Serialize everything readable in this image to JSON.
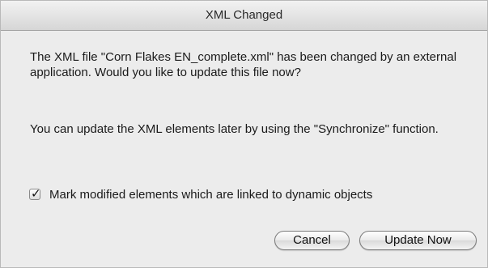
{
  "dialog": {
    "title": "XML Changed",
    "message_primary": "The XML file \"Corn Flakes EN_complete.xml\" has been changed by an external application. Would you like to update this file now?",
    "message_secondary": "You can update the XML elements later by using the \"Synchronize\" function.",
    "checkbox": {
      "label": "Mark modified elements which are linked to dynamic objects",
      "checked": true
    },
    "buttons": {
      "cancel_label": "Cancel",
      "update_label": "Update Now"
    }
  }
}
